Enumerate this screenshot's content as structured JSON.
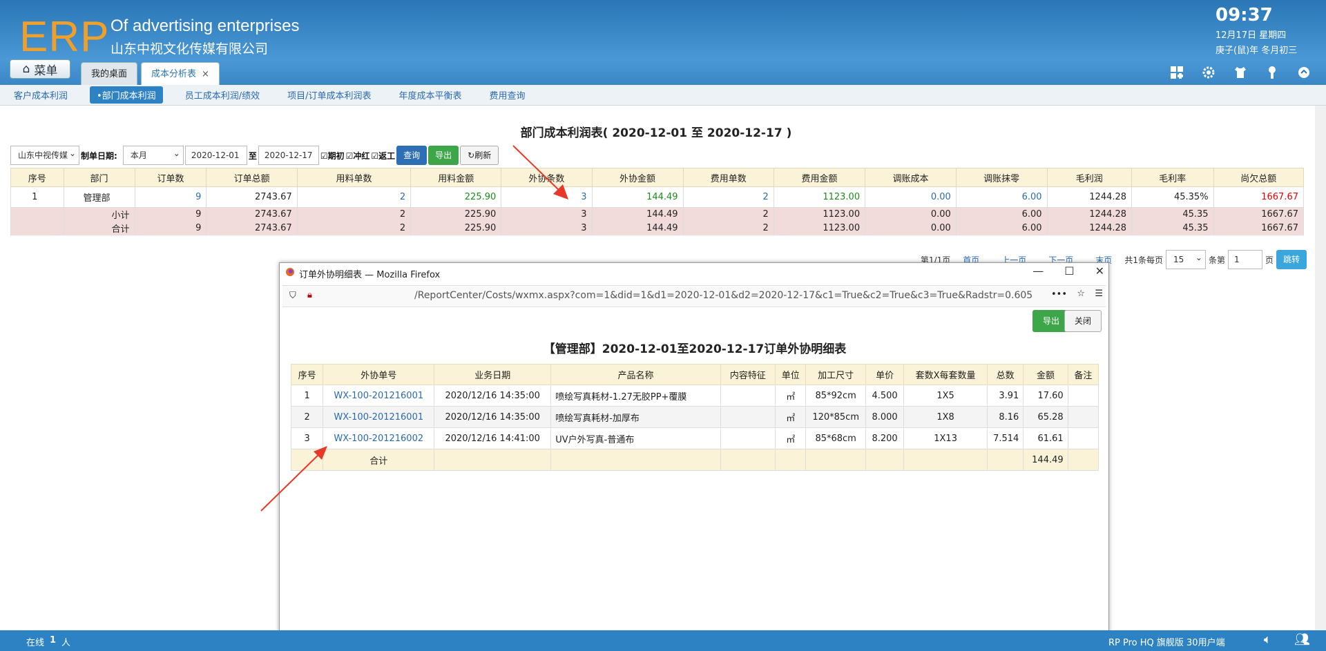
{
  "header": {
    "logo": "ERP",
    "enterprise_en": "Of advertising enterprises",
    "enterprise_cn": "山东中视文化传媒有限公司",
    "time": "09:37",
    "date": "12月17日 星期四",
    "lunar": "庚子(鼠)年 冬月初三",
    "menu_label": "菜单"
  },
  "tabs": [
    {
      "label": "我的桌面"
    },
    {
      "label": "成本分析表",
      "close": "×"
    }
  ],
  "subnav": [
    "客户成本利润",
    "•部门成本利润",
    "员工成本利润/绩效",
    "项目/订单成本利润表",
    "年度成本平衡表",
    "费用查询"
  ],
  "report": {
    "title": "部门成本利润表( 2020-12-01 至 2020-12-17 )"
  },
  "filter": {
    "company": "山东中视传媒",
    "date_label": "制单日期:",
    "period": "本月",
    "from": "2020-12-01",
    "to_label": "至",
    "to": "2020-12-17",
    "chk1": "☑期初",
    "chk2": "☑冲红",
    "chk3": "☑返工",
    "query": "查询",
    "export": "导出",
    "refresh": "刷新"
  },
  "main_table": {
    "headers": [
      "序号",
      "部门",
      "订单数",
      "订单总额",
      "用料单数",
      "用料金额",
      "外协条数",
      "外协金额",
      "费用单数",
      "费用金额",
      "调账成本",
      "调账抹零",
      "毛利润",
      "毛利率",
      "尚欠总额"
    ],
    "row": [
      "1",
      "管理部",
      "9",
      "2743.67",
      "2",
      "225.90",
      "3",
      "144.49",
      "2",
      "1123.00",
      "0.00",
      "6.00",
      "1244.28",
      "45.35%",
      "1667.67"
    ],
    "subtotal": [
      "小计",
      "9",
      "2743.67",
      "2",
      "225.90",
      "3",
      "144.49",
      "2",
      "1123.00",
      "0.00",
      "6.00",
      "1244.28",
      "45.35",
      "1667.67"
    ],
    "total": [
      "合计",
      "9",
      "2743.67",
      "2",
      "225.90",
      "3",
      "144.49",
      "2",
      "1123.00",
      "0.00",
      "6.00",
      "1244.28",
      "45.35",
      "1667.67"
    ]
  },
  "pager": {
    "info": "第1/1页",
    "first": "首页",
    "prev": "上一页",
    "next": "下一页",
    "last": "末页",
    "count": "共1条每页",
    "size": "15",
    "per": "条第",
    "page": "1",
    "unit": "页",
    "go": "跳转"
  },
  "popup": {
    "window_title": "订单外协明细表 — Mozilla Firefox",
    "url": "/ReportCenter/Costs/wxmx.aspx?com=1&did=1&d1=2020-12-01&d2=2020-12-17&c1=True&c2=True&c3=True&Radstr=0.605932",
    "export": "导出",
    "close": "关闭",
    "title": "【管理部】2020-12-01至2020-12-17订单外协明细表",
    "headers": [
      "序号",
      "外协单号",
      "业务日期",
      "产品名称",
      "内容特征",
      "单位",
      "加工尺寸",
      "单价",
      "套数X每套数量",
      "总数",
      "金额",
      "备注"
    ],
    "rows": [
      [
        "1",
        "WX-100-201216001",
        "2020/12/16 14:35:00",
        "喷绘写真耗材-1.27无胶PP+覆膜",
        "",
        "㎡",
        "85*92cm",
        "4.500",
        "1X5",
        "3.91",
        "17.60",
        ""
      ],
      [
        "2",
        "WX-100-201216001",
        "2020/12/16 14:35:00",
        "喷绘写真耗材-加厚布",
        "",
        "㎡",
        "120*85cm",
        "8.000",
        "1X8",
        "8.16",
        "65.28",
        ""
      ],
      [
        "3",
        "WX-100-201216002",
        "2020/12/16 14:41:00",
        "UV户外写真-普通布",
        "",
        "㎡",
        "85*68cm",
        "8.200",
        "1X13",
        "7.514",
        "61.61",
        ""
      ]
    ],
    "total_label": "合计",
    "total_amount": "144.49"
  },
  "status": {
    "online": "在线",
    "count": "1",
    "unit": "人",
    "version": "RP Pro HQ 旗舰版 30用户端"
  }
}
